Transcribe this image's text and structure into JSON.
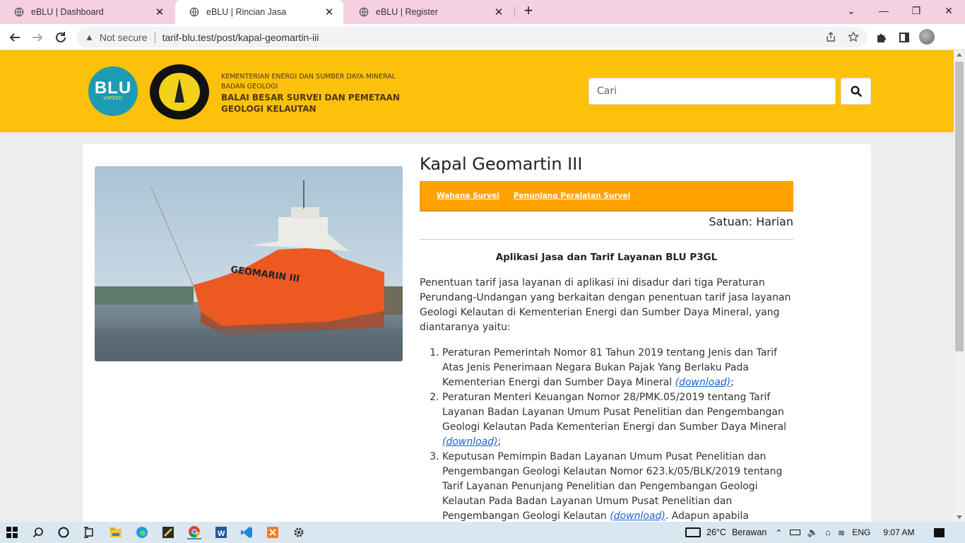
{
  "browser": {
    "tabs": [
      {
        "label": "eBLU | Dashboard",
        "active": false
      },
      {
        "label": "eBLU | Rincian Jasa",
        "active": true
      },
      {
        "label": "eBLU | Register",
        "active": false
      }
    ],
    "security_label": "Not secure",
    "url": "tarif-blu.test/post/kapal-geomartin-iii"
  },
  "header": {
    "logo_text": "BLU",
    "logo_subtext": "eSPEED",
    "institution": {
      "line1": "KEMENTERIAN ENERGI DAN SUMBER DAYA MINERAL",
      "line2": "BADAN GEOLOGI",
      "line3": "BALAI BESAR SURVEI DAN PEMETAAN",
      "line4": "GEOLOGI KELAUTAN"
    },
    "search_placeholder": "Cari",
    "colors": {
      "header_bg": "#fcc10a",
      "category_bar": "#ffa200"
    }
  },
  "product": {
    "ship_name": "GEOMARIN III",
    "title": "Kapal Geomartin III",
    "categories": [
      "Wahana Survei",
      "Penunjang Peralatan Survei"
    ],
    "unit": "Satuan: Harian",
    "subtitle": "Aplikasi Jasa dan Tarif Layanan BLU P3GL",
    "intro": "Penentuan tarif jasa layanan di aplikasi ini disadur dari tiga Peraturan Perundang-Undangan yang berkaitan dengan penentuan tarif jasa layanan Geologi Kelautan di Kementerian Energi dan Sumber Daya Mineral, yang diantaranya yaitu:",
    "regulations": [
      {
        "text": "Peraturan Pemerintah Nomor 81 Tahun 2019 tentang Jenis dan Tarif Atas Jenis Penerimaan Negara Bukan Pajak Yang Berlaku Pada Kementerian Energi dan Sumber Daya Mineral ",
        "link": "(download)",
        "after": ";"
      },
      {
        "text": "Peraturan Menteri Keuangan Nomor 28/PMK.05/2019 tentang Tarif Layanan Badan Layanan Umum Pusat Penelitian dan Pengembangan Geologi Kelautan Pada Kementerian Energi dan Sumber Daya Mineral ",
        "link": "(download)",
        "after": ";"
      },
      {
        "text": "Keputusan Pemimpin Badan Layanan Umum Pusat Penelitian dan Pengembangan Geologi Kelautan Nomor 623.k/05/BLK/2019 tentang Tarif Layanan Penunjang Penelitian dan Pengembangan Geologi Kelautan Pada Badan Layanan Umum Pusat Penelitian dan Pengembangan Geologi Kelautan ",
        "link": "(download)",
        "after": ". Adapun apabila"
      }
    ]
  },
  "taskbar": {
    "temperature": "26°C",
    "weather": "Berawan",
    "language": "ENG",
    "time": "9:07 AM"
  }
}
